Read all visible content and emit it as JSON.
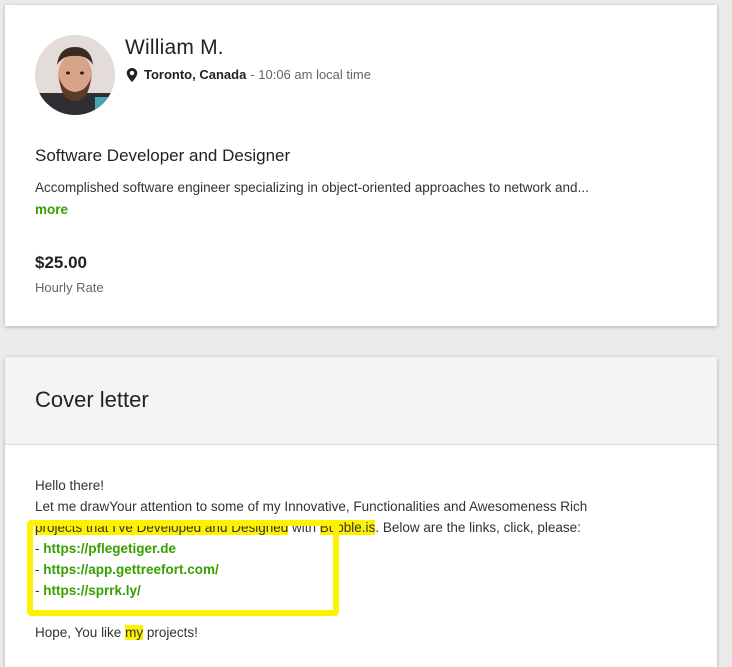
{
  "profile": {
    "name": "William M.",
    "location_city": "Toronto, Canada",
    "location_time": "- 10:06 am local time",
    "title": "Software Developer and Designer",
    "overview": "Accomplished software engineer specializing in object-oriented approaches to network and...",
    "more_label": "more",
    "rate": "$25.00",
    "rate_label": "Hourly Rate"
  },
  "cover": {
    "title": "Cover letter",
    "greeting": "Hello there!",
    "line1": "Let me drawYour attention to some of my Innovative, Functionalities and Awesomeness Rich",
    "line2_hl1": "projects that I've Developed and Designed",
    "line2_mid": " with ",
    "line2_hl2": "Bubble.is",
    "line2_end": ". Below are the links, click, please:",
    "link_prefix": "- ",
    "links": [
      "https://pflegetiger.de",
      "https://app.gettreefort.com/",
      "https://sprrk.ly/"
    ],
    "closing_pre": "Hope, You like ",
    "closing_hl": "my",
    "closing_post": " projects!"
  },
  "colors": {
    "accent": "#37a000",
    "highlight": "#fff200"
  }
}
